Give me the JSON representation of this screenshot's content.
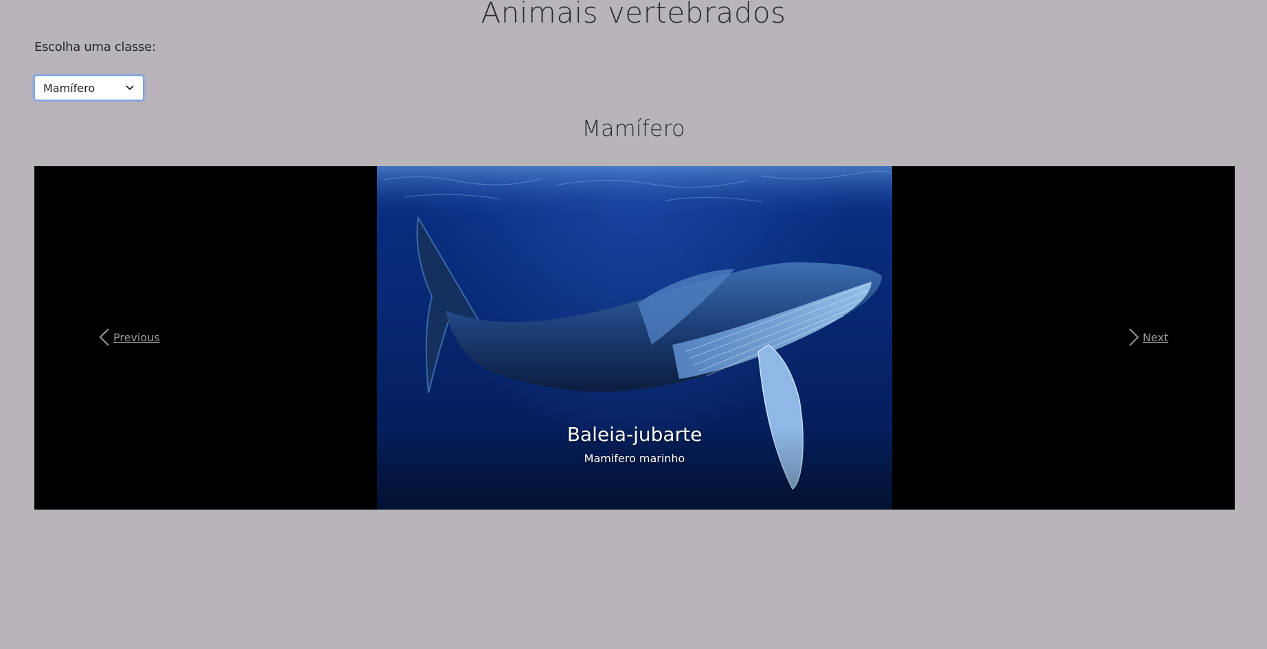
{
  "page": {
    "title": "Animais vertebrados",
    "select_label": "Escolha uma classe:"
  },
  "class_select": {
    "selected": "Mamífero",
    "icon": "chevron-down-icon"
  },
  "section": {
    "title": "Mamífero"
  },
  "carousel": {
    "slide": {
      "title": "Baleia-jubarte",
      "subtitle": "Mamifero marinho"
    },
    "prev_label": "Previous",
    "next_label": "Next",
    "prev_icon": "chevron-left-icon",
    "next_icon": "chevron-right-icon"
  },
  "colors": {
    "background": "#b9b4ba",
    "carousel_bg": "#000000",
    "ocean": "#072873",
    "select_focus": "#7aa1e8"
  }
}
